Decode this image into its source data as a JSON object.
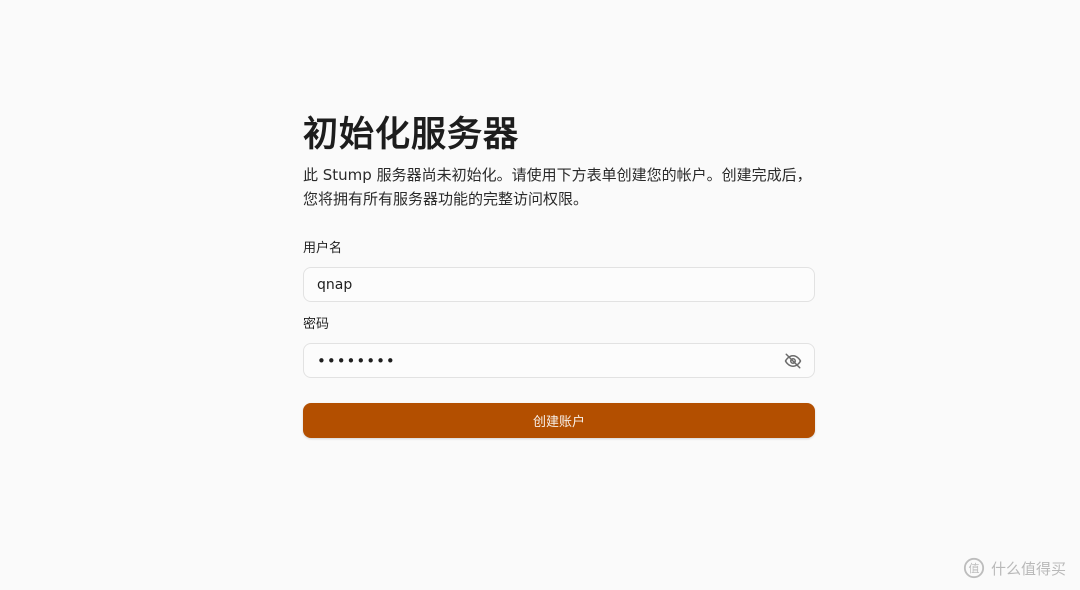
{
  "page": {
    "title": "初始化服务器",
    "description": "此 Stump 服务器尚未初始化。请使用下方表单创建您的帐户。创建完成后，您将拥有所有服务器功能的完整访问权限。"
  },
  "form": {
    "username_label": "用户名",
    "username_value": "qnap",
    "password_label": "密码",
    "password_value": "qnapqnap",
    "password_toggle_icon": "eye-off-icon",
    "submit_label": "创建账户"
  },
  "watermark": {
    "text": "什么值得买"
  },
  "colors": {
    "accent": "#b34f00",
    "background": "#fafafa",
    "input_border": "#e2e2e2"
  }
}
